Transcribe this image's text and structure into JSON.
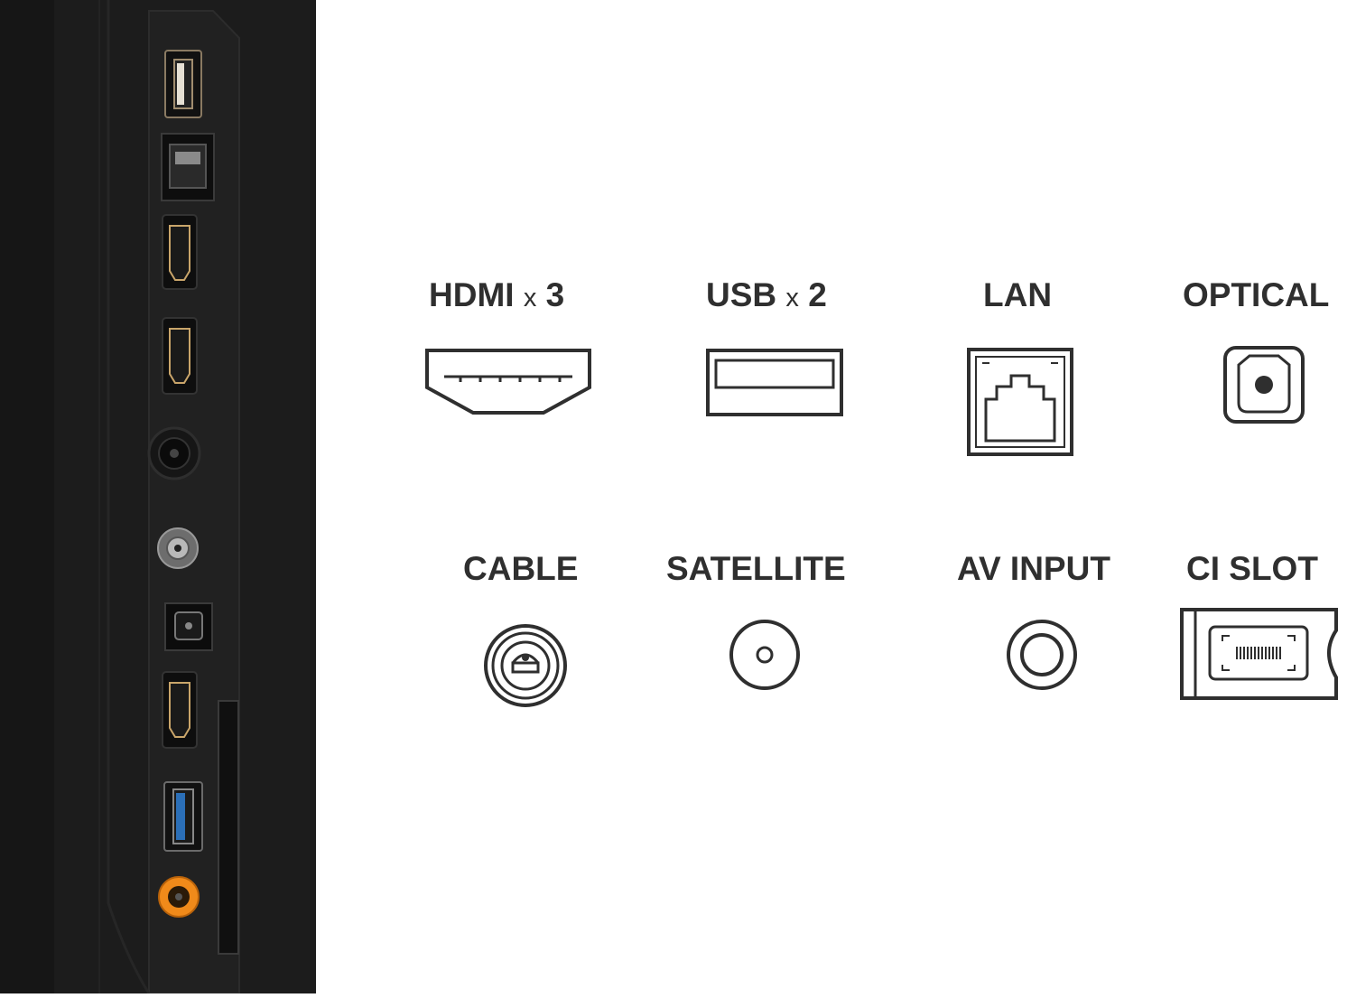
{
  "labels": {
    "hdmi": {
      "name": "HDMI",
      "suffix": "x",
      "count": "3"
    },
    "usb": {
      "name": "USB",
      "suffix": "x",
      "count": "2"
    },
    "lan": "LAN",
    "optical": "OPTICAL",
    "cable": "CABLE",
    "satellite": "SATELLITE",
    "av_input": "AV INPUT",
    "ci_slot": "CI SLOT"
  },
  "icons": [
    "hdmi-icon",
    "usb-icon",
    "lan-icon",
    "optical-icon",
    "cable-icon",
    "satellite-icon",
    "av-input-icon",
    "ci-slot-icon"
  ],
  "colors": {
    "panel": "#1c1c1c",
    "text": "#2f2f2f",
    "usb3_blue": "#2b6fb8",
    "av_orange": "#f08a1a"
  }
}
